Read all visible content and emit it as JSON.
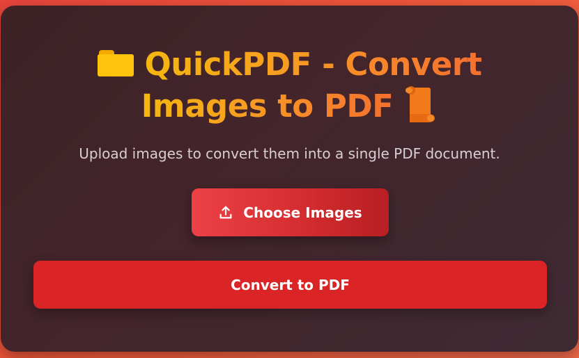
{
  "header": {
    "title_line1": "QuickPDF - Convert",
    "title_line2": "Images to PDF",
    "leading_icon": "folder-icon",
    "trailing_icon": "scroll-icon"
  },
  "subtitle": "Upload images to convert them into a single PDF document.",
  "actions": {
    "choose_label": "Choose Images",
    "choose_icon": "upload-icon",
    "convert_label": "Convert to PDF"
  },
  "colors": {
    "background": "#ef4f3c",
    "card": "#40242a",
    "title_gradient_start": "#f5b70f",
    "title_gradient_end": "#f46f2e",
    "choose_button": "#d72f32",
    "convert_button": "#da2425",
    "subtitle_text": "#d8cfd2"
  }
}
